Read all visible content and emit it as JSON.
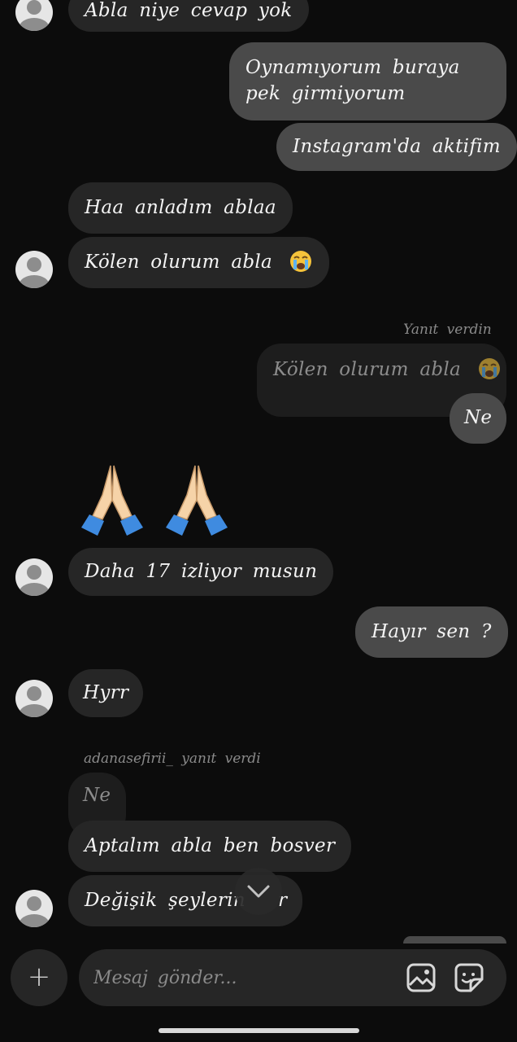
{
  "messages": [
    {
      "text": "Abla niye cevap yok"
    },
    {
      "text": "Oynamıyorum buraya pek girmiyorum"
    },
    {
      "text": "Instagram'da aktifim"
    },
    {
      "text": "Haa anladım ablaa"
    },
    {
      "text": "Kölen olurum abla"
    },
    {
      "text": "Ne"
    },
    {
      "text": "Daha 17 izliyor musun"
    },
    {
      "text": "Hayır sen ?"
    },
    {
      "text": "Hyrr"
    },
    {
      "text": "Aptalım abla ben bosver"
    },
    {
      "text": "Değişik şeylerin",
      "tail": "r"
    }
  ],
  "replies": {
    "mine_label": "Yanıt verdin",
    "mine_quote": "Kölen olurum abla",
    "theirs_label": "adanasefirii_ yanıt verdi",
    "theirs_quote": "Ne"
  },
  "emojis": {
    "crying": "crying-face",
    "folded_hands": "folded-hands"
  },
  "composer": {
    "placeholder": "Mesaj gönder..."
  }
}
